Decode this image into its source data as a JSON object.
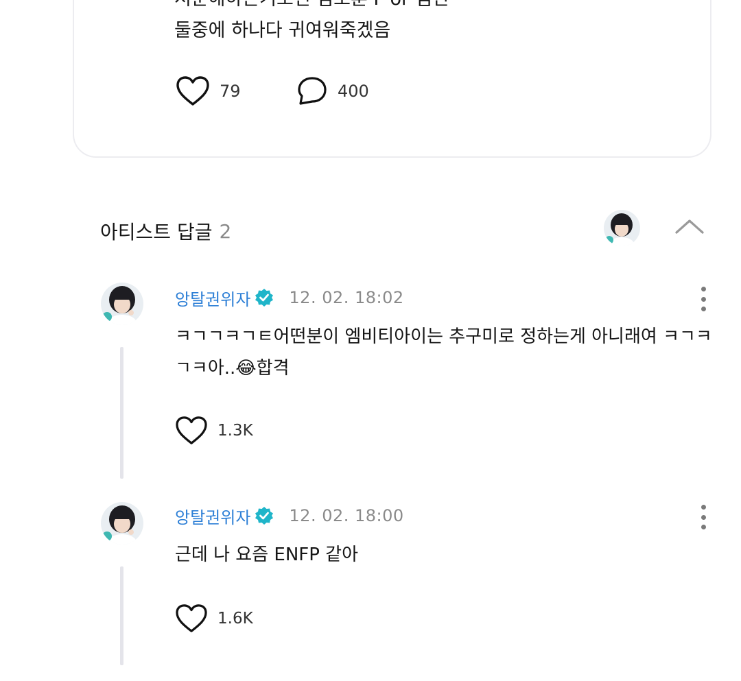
{
  "post": {
    "text": "서운해하는거보면 김도훈 F or 잼민\n둘중에 하나다 귀여워죽겠음",
    "likes": "79",
    "comments": "400"
  },
  "replies_header": {
    "label": "아티스트 답글",
    "count": "2"
  },
  "replies": [
    {
      "author": "앙탈권위자",
      "timestamp": "12. 02. 18:02",
      "text": "ㅋㄱㄱㅋㄱㅌ어떤분이 엠비티아이는 추구미로 정하는게 아니래여 ㅋㄱㅋ\nㄱㅋ아..😂합격",
      "likes": "1.3K"
    },
    {
      "author": "앙탈권위자",
      "timestamp": "12. 02. 18:00",
      "text": "근데 나 요즘 ENFP 같아",
      "likes": "1.6K"
    }
  ],
  "colors": {
    "author": "#2d7fd6",
    "verified_badge": "#1fb5c9",
    "muted": "#8a8a8a",
    "thread_line": "#e4e4ea"
  },
  "icons": {
    "like": "heart-outline-icon",
    "comment": "speech-bubble-icon",
    "verified": "verified-badge-icon",
    "collapse": "chevron-up-icon",
    "more": "more-vertical-icon"
  }
}
